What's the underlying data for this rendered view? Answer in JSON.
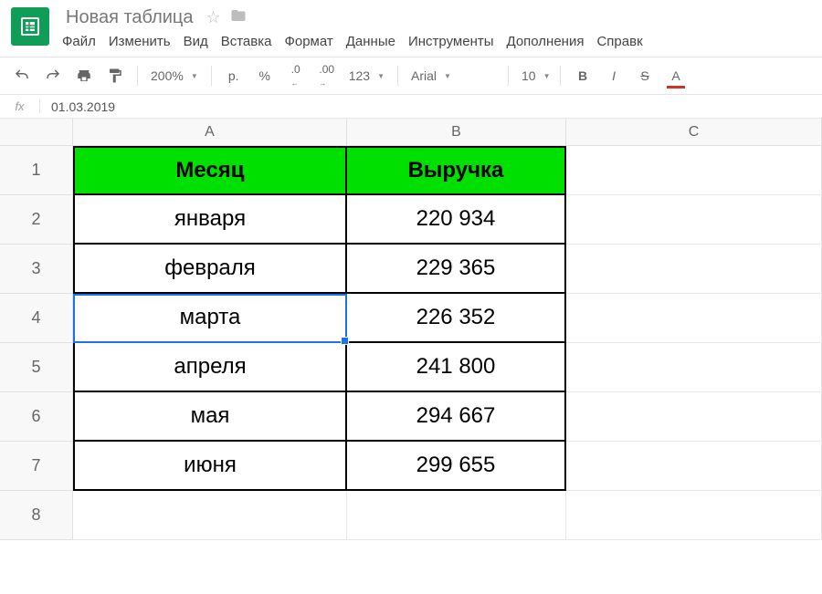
{
  "header": {
    "title": "Новая таблица",
    "menu": [
      "Файл",
      "Изменить",
      "Вид",
      "Вставка",
      "Формат",
      "Данные",
      "Инструменты",
      "Дополнения",
      "Справк"
    ]
  },
  "toolbar": {
    "zoom": "200%",
    "currency": "р.",
    "percent": "%",
    "dec_dec": ".0",
    "dec_inc": ".00",
    "numfmt": "123",
    "font": "Arial",
    "size": "10",
    "bold": "B",
    "italic": "I",
    "strike": "S",
    "textcolor": "A"
  },
  "formula_bar": {
    "label": "fx",
    "value": "01.03.2019"
  },
  "columns": [
    "A",
    "B",
    "C"
  ],
  "row_numbers": [
    "1",
    "2",
    "3",
    "4",
    "5",
    "6",
    "7",
    "8"
  ],
  "table": {
    "headers": {
      "A": "Месяц",
      "B": "Выручка"
    },
    "rows": [
      {
        "A": "января",
        "B": "220 934"
      },
      {
        "A": "февраля",
        "B": "229 365"
      },
      {
        "A": "марта",
        "B": "226 352"
      },
      {
        "A": "апреля",
        "B": "241 800"
      },
      {
        "A": "мая",
        "B": "294 667"
      },
      {
        "A": "июня",
        "B": "299 655"
      }
    ]
  },
  "selected_cell": "A4"
}
